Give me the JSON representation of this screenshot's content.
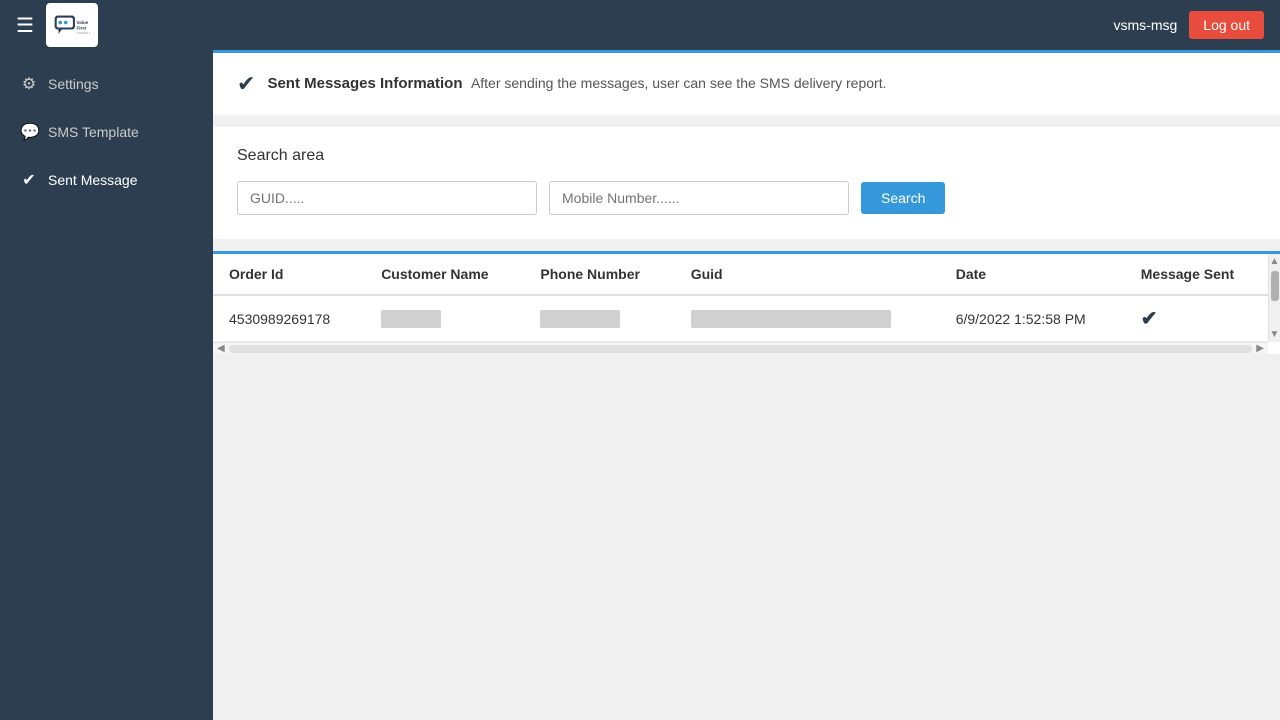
{
  "app": {
    "name": "ValueFirst",
    "subtitle": "A TWILIO COMPANY"
  },
  "navbar": {
    "toggle_icon": "☰",
    "user": "vsms-msg",
    "logout_label": "Log out"
  },
  "sidebar": {
    "items": [
      {
        "id": "settings",
        "label": "Settings",
        "icon": "⚙"
      },
      {
        "id": "sms-template",
        "label": "SMS Template",
        "icon": "💬"
      },
      {
        "id": "sent-message",
        "label": "Sent Message",
        "icon": "✔",
        "active": true
      }
    ]
  },
  "info_banner": {
    "icon": "✔",
    "title": "Sent Messages Information",
    "description": "After sending the messages, user can see the SMS delivery report."
  },
  "search_area": {
    "title": "Search area",
    "guid_placeholder": "GUID.....",
    "mobile_placeholder": "Mobile Number......",
    "search_button_label": "Search"
  },
  "table": {
    "columns": [
      {
        "id": "order-id",
        "label": "Order Id"
      },
      {
        "id": "customer-name",
        "label": "Customer Name"
      },
      {
        "id": "phone-number",
        "label": "Phone Number"
      },
      {
        "id": "guid",
        "label": "Guid"
      },
      {
        "id": "date",
        "label": "Date"
      },
      {
        "id": "message-sent",
        "label": "Message Sent"
      }
    ],
    "rows": [
      {
        "order_id": "4530989269178",
        "customer_name": "",
        "phone_number": "",
        "guid": "",
        "date": "6/9/2022 1:52:58 PM",
        "message_sent": true
      }
    ]
  }
}
